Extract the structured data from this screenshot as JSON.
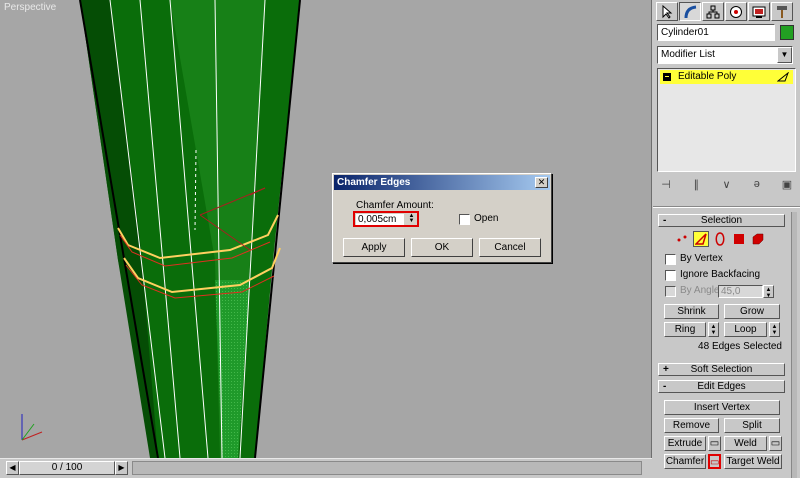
{
  "viewport": {
    "label": "Perspective"
  },
  "timeline": {
    "frame_display": "0 / 100",
    "prev_icon": "arrow-left-icon",
    "next_icon": "arrow-right-icon"
  },
  "command_panel": {
    "tabs": [
      {
        "id": "create",
        "icon": "pointer-icon"
      },
      {
        "id": "modify",
        "icon": "modify-bend-icon"
      },
      {
        "id": "hierarchy",
        "icon": "hierarchy-icon"
      },
      {
        "id": "motion",
        "icon": "motion-icon"
      },
      {
        "id": "display",
        "icon": "display-monitor-icon"
      },
      {
        "id": "utilities",
        "icon": "hammer-icon"
      }
    ],
    "object_name": "Cylinder01",
    "object_color": "#22a022",
    "modifier_list": "Modifier List",
    "stack": [
      {
        "label": "Editable Poly",
        "highlight": "#ffff38"
      }
    ],
    "selection": {
      "title": "Selection",
      "by_vertex": "By Vertex",
      "ignore_backfacing": "Ignore Backfacing",
      "by_angle": "By Angle:",
      "angle_value": "45,0",
      "shrink": "Shrink",
      "grow": "Grow",
      "ring": "Ring",
      "loop": "Loop",
      "status": "48 Edges Selected"
    },
    "soft_selection": {
      "title": "Soft Selection"
    },
    "edit_edges": {
      "title": "Edit Edges",
      "insert_vertex": "Insert Vertex",
      "remove": "Remove",
      "split": "Split",
      "extrude": "Extrude",
      "weld": "Weld",
      "chamfer": "Chamfer",
      "target_weld": "Target Weld"
    }
  },
  "dialog": {
    "title": "Chamfer Edges",
    "amount_label": "Chamfer Amount:",
    "amount_value": "0,005cm",
    "open_label": "Open",
    "apply": "Apply",
    "ok": "OK",
    "cancel": "Cancel",
    "close_glyph": "✕"
  },
  "colors": {
    "selection_yellow": "#ffff38",
    "highlight_red": "#e00000",
    "mesh_green": "#1e8a1e"
  }
}
